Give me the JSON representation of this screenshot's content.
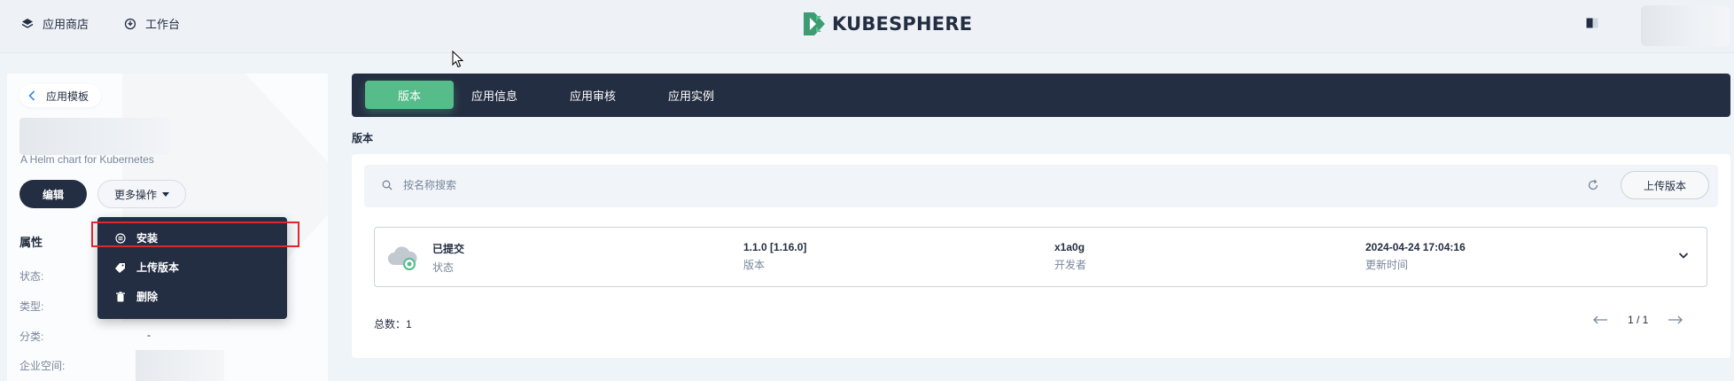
{
  "topbar": {
    "app_store_label": "应用商店",
    "workbench_label": "工作台",
    "logo_text": "KUBESPHERE"
  },
  "left_panel": {
    "back_label": "应用模板",
    "description": "A Helm chart for Kubernetes",
    "edit_label": "编辑",
    "more_actions_label": "更多操作",
    "attributes_title": "属性",
    "attributes": [
      {
        "label": "状态:",
        "value": ""
      },
      {
        "label": "类型:",
        "value": ""
      },
      {
        "label": "分类:",
        "value": "-"
      },
      {
        "label": "企业空间:",
        "value": ""
      }
    ]
  },
  "dropdown": {
    "items": [
      {
        "label": "安装",
        "icon": "install-icon"
      },
      {
        "label": "上传版本",
        "icon": "tag-icon"
      },
      {
        "label": "删除",
        "icon": "trash-icon"
      }
    ]
  },
  "tabs": [
    {
      "label": "版本",
      "active": true
    },
    {
      "label": "应用信息",
      "active": false
    },
    {
      "label": "应用审核",
      "active": false
    },
    {
      "label": "应用实例",
      "active": false
    }
  ],
  "main": {
    "section_label": "版本",
    "search_placeholder": "按名称搜索",
    "upload_label": "上传版本",
    "version_row": {
      "status_value": "已提交",
      "status_key": "状态",
      "version_value": "1.1.0 [1.16.0]",
      "version_key": "版本",
      "developer_value": "x1a0g",
      "developer_key": "开发者",
      "updated_value": "2024-04-24 17:04:16",
      "updated_key": "更新时间"
    },
    "total_label": "总数：1",
    "page_label": "1 / 1"
  },
  "colors": {
    "dark": "#242e42",
    "accent": "#55bc8a",
    "highlight": "#e0262f"
  }
}
